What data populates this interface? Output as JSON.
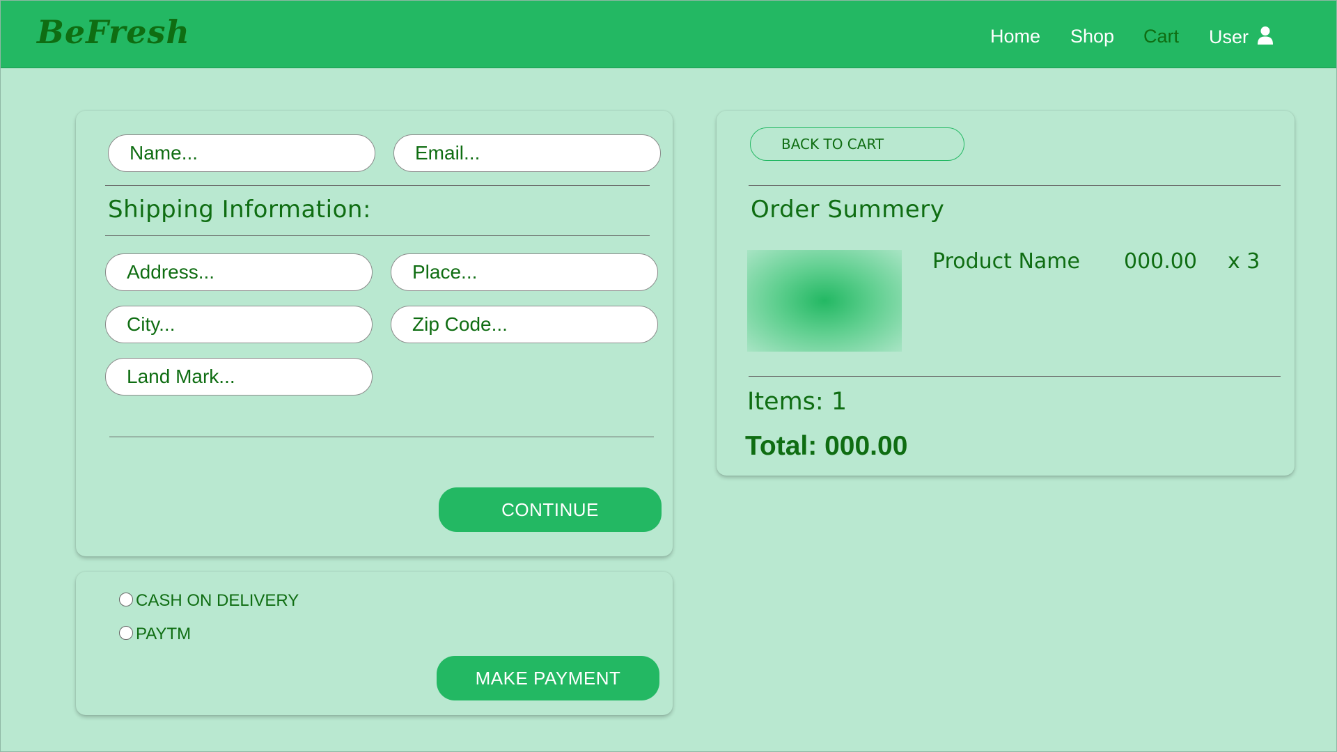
{
  "brand": "BeFresh",
  "nav": {
    "home": "Home",
    "shop": "Shop",
    "cart": "Cart",
    "user": "User"
  },
  "checkout_form": {
    "name_placeholder": "Name...",
    "email_placeholder": "Email...",
    "shipping_title": "Shipping Information:",
    "address_placeholder": "Address...",
    "place_placeholder": "Place...",
    "city_placeholder": "City...",
    "zip_placeholder": "Zip Code...",
    "landmark_placeholder": "Land Mark...",
    "continue_label": "CONTINUE"
  },
  "payment": {
    "options": [
      "CASH ON DELIVERY",
      "PAYTM"
    ],
    "make_payment_label": "MAKE PAYMENT"
  },
  "summary": {
    "back_label": "BACK TO CART",
    "title": "Order Summery",
    "item": {
      "name": "Product Name",
      "price": "000.00",
      "quantity": "x 3"
    },
    "items_label": "Items:",
    "items_count": "1",
    "total_label": "Total:",
    "total_value": "000.00"
  },
  "colors": {
    "accent": "#23b863",
    "text": "#0f6d12",
    "background": "#b9e8d0"
  }
}
